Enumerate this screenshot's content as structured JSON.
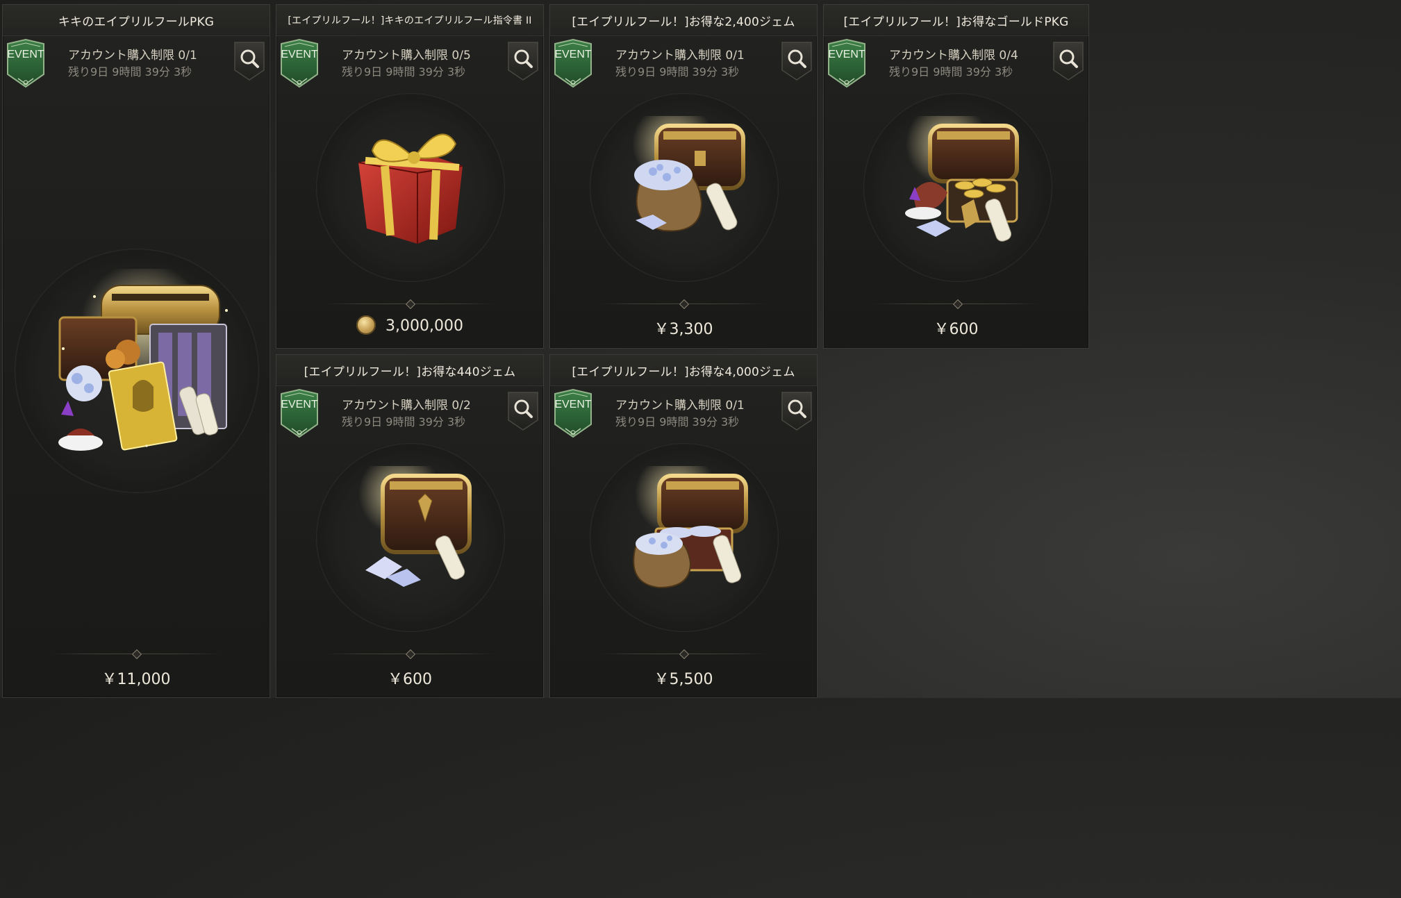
{
  "badge_text": "EVENT",
  "colors": {
    "badge_green": "#2f6a3a",
    "badge_border": "#8fae86",
    "gold": "#c9a24e",
    "price_text": "#efe9dc"
  },
  "cards": [
    {
      "title": "キキのエイプリルフールPKG",
      "limit": "アカウント購入制限 0/1",
      "remaining": "残り9日 9時間 39分 3秒",
      "price": "￥11,000",
      "icon": "package-bundle-icon"
    },
    {
      "title": "[エイプリルフール！]キキのエイプリルフール指令書 II",
      "limit": "アカウント購入制限 0/5",
      "remaining": "残り9日 9時間 39分 3秒",
      "price": "3,000,000",
      "price_icon": "gold-coin-icon",
      "icon": "gift-box-icon"
    },
    {
      "title": "[エイプリルフール！]お得な2,400ジェム",
      "limit": "アカウント購入制限 0/1",
      "remaining": "残り9日 9時間 39分 3秒",
      "price": "￥3,300",
      "icon": "treasure-chest-gems-icon"
    },
    {
      "title": "[エイプリルフール！]お得なゴールドPKG",
      "limit": "アカウント購入制限 0/4",
      "remaining": "残り9日 9時間 39分 3秒",
      "price": "￥600",
      "icon": "treasure-chest-gold-icon"
    },
    {
      "title": "[エイプリルフール！]お得な440ジェム",
      "limit": "アカウント購入制限 0/2",
      "remaining": "残り9日 9時間 39分 3秒",
      "price": "￥600",
      "icon": "treasure-chest-gems-icon"
    },
    {
      "title": "[エイプリルフール！]お得な4,000ジェム",
      "limit": "アカウント購入制限 0/1",
      "remaining": "残り9日 9時間 39分 3秒",
      "price": "￥5,500",
      "icon": "treasure-chest-gems-icon"
    }
  ]
}
